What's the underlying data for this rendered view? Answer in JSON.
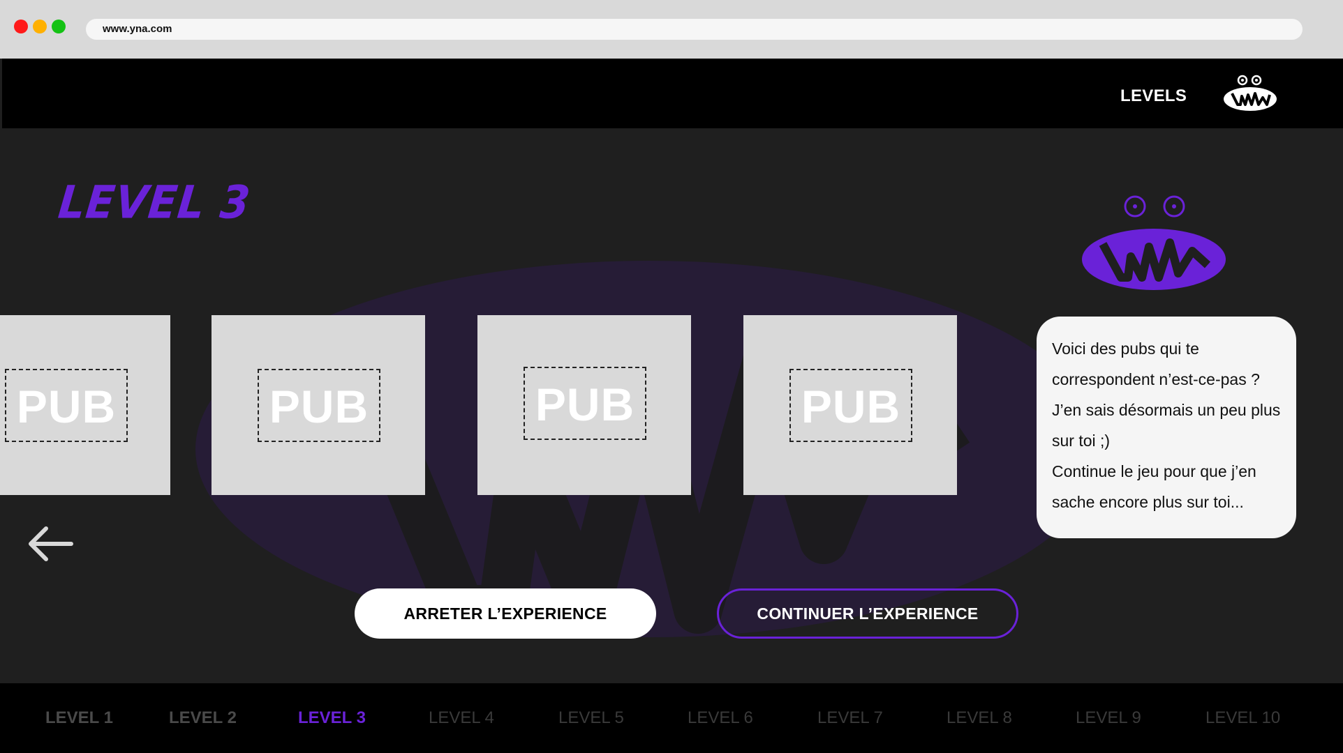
{
  "browser": {
    "url": "www.yna.com"
  },
  "header": {
    "levels_link": "LEVELS"
  },
  "main": {
    "title": "LEVEL 3",
    "pub_cards": [
      "PUB",
      "PUB",
      "PUB",
      "PUB"
    ],
    "bubble": {
      "line1": "Voici des pubs qui te",
      "line2": "correspondent n’est-ce-pas ?",
      "line3": "J’en sais désormais un peu plus",
      "line4": "sur toi ;)",
      "line5": "Continue le jeu pour que j’en",
      "line6": "sache encore plus sur toi..."
    },
    "stop_button": "ARRETER L’EXPERIENCE",
    "continue_button": "CONTINUER L’EXPERIENCE"
  },
  "levelbar": {
    "items": [
      "LEVEL 1",
      "LEVEL 2",
      "LEVEL 3",
      "LEVEL 4",
      "LEVEL 5",
      "LEVEL 6",
      "LEVEL 7",
      "LEVEL 8",
      "LEVEL 9",
      "LEVEL 10"
    ],
    "active": "LEVEL 3"
  },
  "colors": {
    "accent": "#6a22d8",
    "background": "#1f1f1f",
    "card": "#d9d9d9"
  },
  "icons": {
    "back": "arrow-left-icon",
    "logo": "yna-logo-icon"
  }
}
